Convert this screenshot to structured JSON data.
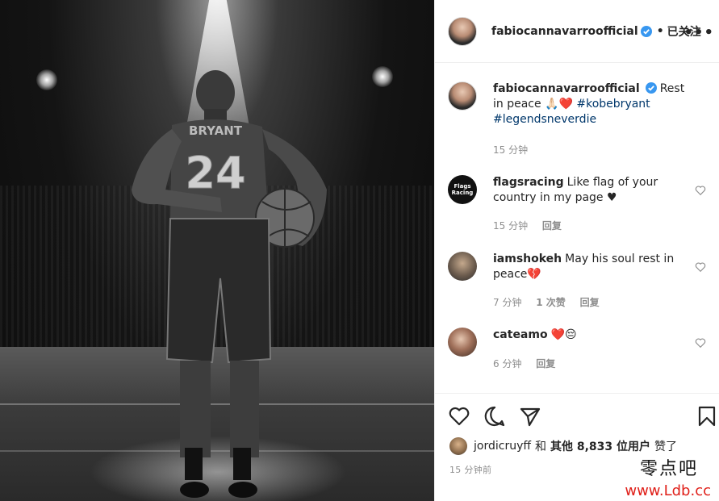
{
  "post": {
    "owner": "fabiocannavarroofficial",
    "follow_status": "已关注",
    "more_glyph": "•••",
    "caption": {
      "text": "Rest in peace",
      "emoji": "🙏🏻❤️",
      "hashtags": [
        "#kobebryant",
        "#legendsneverdie"
      ],
      "time": "15 分钟"
    },
    "photo": {
      "jersey_name": "BRYANT",
      "jersey_number": "24"
    }
  },
  "comments": [
    {
      "username": "flagsracing",
      "avatar_text": "Flags Racing",
      "text": "Like flag of your country in my page ♥",
      "time": "15 分钟",
      "reply": "回复"
    },
    {
      "username": "iamshokeh",
      "text": "May his soul rest in peace💔",
      "time": "7 分钟",
      "likes": "1 次赞",
      "reply": "回复"
    },
    {
      "username": "cateamo",
      "text": "❤️😔",
      "time": "6 分钟",
      "reply": "回复"
    }
  ],
  "likes": {
    "user": "jordicruyff",
    "and": "和",
    "others": "其他 8,833 位用户",
    "suffix": "赞了"
  },
  "timestamp": "15 分钟前",
  "watermark": {
    "cn": "零点吧",
    "url": "www.Ldb.cc"
  },
  "colors": {
    "verified": "#3897f0",
    "heart": "#ed4956",
    "hashtag": "#00376b",
    "meta": "#8e8e8e"
  }
}
